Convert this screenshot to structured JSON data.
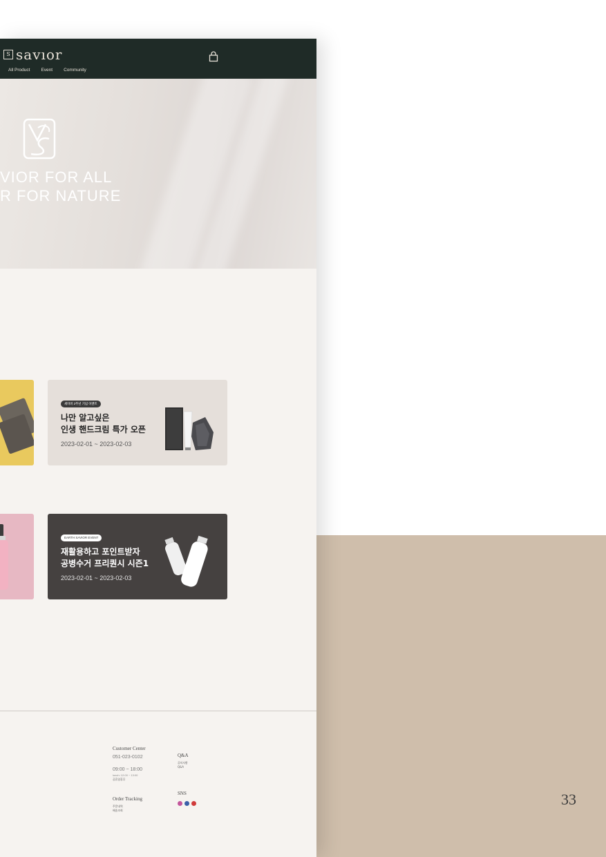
{
  "header": {
    "logo_text": "savıor",
    "logo_mark": "S",
    "nav": [
      "All Product",
      "Event",
      "Community"
    ],
    "cart_icon": "shopping-bag-icon"
  },
  "hero": {
    "line1": "VIOR FOR ALL",
    "line2": "R FOR NATURE",
    "emblem_icon": "vs-monogram-icon"
  },
  "events": [
    {
      "badge": "세이버 2주년 기념 이벤트",
      "title_line1": "나만 알고싶은",
      "title_line2": "인생 핸드크림 특가 오픈",
      "date": "2023-02-01 ~ 2023-02-03",
      "bg": "#e5dfda"
    },
    {
      "badge": "EARTH SAVIOR EVENT",
      "title_line1": "재활용하고 포인트받자",
      "title_line2": "공병수거 프리퀀시 시즌1",
      "date": "2023-02-01 ~ 2023-02-03",
      "bg": "#454140"
    }
  ],
  "left_cards": [
    {
      "bg": "#e9c95e"
    },
    {
      "bg": "#e7b8c3"
    }
  ],
  "footer": {
    "customer_center_title": "Customer Center",
    "phone": "051-023-0102",
    "hours": "09:00 ~ 18:00",
    "lunch": "lunch: 12:00 ~ 13:00",
    "holiday": "공휴일휴무",
    "qa_title": "Q&A",
    "qa_items": [
      "공지사항",
      "Q&A"
    ],
    "order_title": "Order Tracking",
    "order_items": [
      "주문내역",
      "배송조회"
    ],
    "sns_title": "SNS",
    "sns_icons": [
      "instagram-icon",
      "facebook-icon",
      "youtube-icon"
    ]
  },
  "page_number": "33",
  "colors": {
    "header_bg": "#1f2b27",
    "page_bg": "#f6f3f0",
    "side_panel": "#cfbeab"
  }
}
